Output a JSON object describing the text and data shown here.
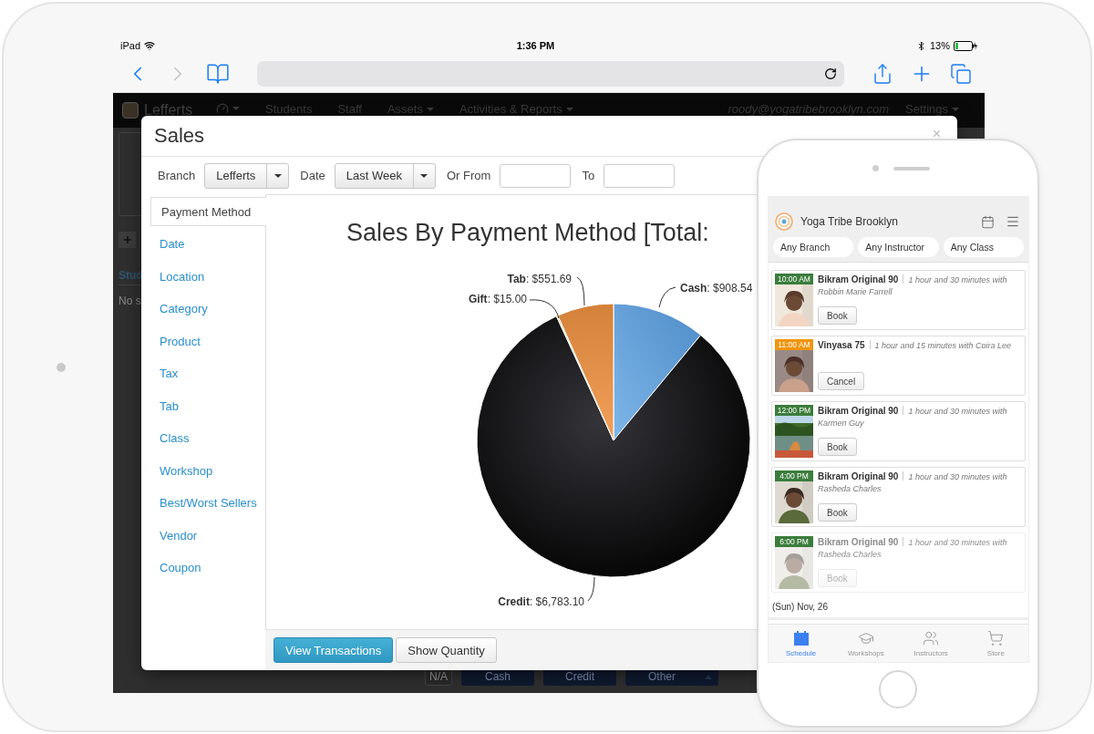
{
  "ipad_status_bar": {
    "device": "iPad",
    "time": "1:36 PM",
    "battery": "13%"
  },
  "browser": {
    "nav_buttons": [
      {
        "kind": "back",
        "disabled": false
      },
      {
        "kind": "forward",
        "disabled": true
      }
    ]
  },
  "web_app": {
    "nav": {
      "branch": "Lefferts",
      "items": [
        {
          "label": "Students",
          "dropdown": false
        },
        {
          "label": "Staff",
          "dropdown": false
        },
        {
          "label": "Assets",
          "dropdown": true
        },
        {
          "label": "Activities & Reports",
          "dropdown": true
        }
      ],
      "user": "roody@yogatribebrooklyn.com",
      "settings": {
        "label": "Settings",
        "dropdown": true
      }
    },
    "background": {
      "column_header": "Stud",
      "empty_text": "No s",
      "tag": "N/A",
      "buttons": [
        "Cash",
        "Credit",
        "Other"
      ]
    }
  },
  "sales_dialog": {
    "title": "Sales",
    "close": "×",
    "filters": [
      {
        "label": "Branch",
        "kind": "select",
        "value": "Lefferts"
      },
      {
        "label": "Date",
        "kind": "select",
        "value": "Last Week"
      },
      {
        "label": "Or From",
        "kind": "input"
      },
      {
        "label": "To",
        "kind": "input"
      }
    ],
    "report_types": [
      {
        "label": "Payment Method",
        "selected": true
      },
      {
        "label": "Date",
        "selected": false
      },
      {
        "label": "Location",
        "selected": false
      },
      {
        "label": "Category",
        "selected": false
      },
      {
        "label": "Product",
        "selected": false
      },
      {
        "label": "Tax",
        "selected": false
      },
      {
        "label": "Tab",
        "selected": false
      },
      {
        "label": "Class",
        "selected": false
      },
      {
        "label": "Workshop",
        "selected": false
      },
      {
        "label": "Best/Worst Sellers",
        "selected": false
      },
      {
        "label": "Vendor",
        "selected": false
      },
      {
        "label": "Coupon",
        "selected": false
      }
    ],
    "chart_title": "Sales By Payment Method [Total:",
    "chart_data": {
      "type": "pie",
      "categories": [
        "Cash",
        "Credit",
        "Gift",
        "Tab"
      ],
      "values": [
        908.54,
        6783.1,
        15.0,
        551.69
      ],
      "value_labels": [
        ": $908.54",
        ": $6,783.10",
        ": $15.00",
        ": $551.69"
      ]
    },
    "buttons": [
      {
        "label": "View Transactions",
        "primary": true
      },
      {
        "label": "Show Quantity",
        "primary": false
      }
    ]
  },
  "phone_app": {
    "title": "Yoga Tribe Brooklyn",
    "filters": [
      "Any Branch",
      "Any Instructor",
      "Any Class"
    ],
    "classes": [
      {
        "time": "10:00 AM",
        "color": "#3b7d3c",
        "name": "Bikram Original 90",
        "details": "1 hour and 30 minutes with Robbin Marie Farrell",
        "action": "Book",
        "disabled": false
      },
      {
        "time": "11:00 AM",
        "color": "#f0950e",
        "name": "Vinyasa 75",
        "details": "1 hour and 15 minutes with Coira Lee",
        "action": "Cancel",
        "disabled": false
      },
      {
        "time": "12:00 PM",
        "color": "#3b7d3c",
        "name": "Bikram Original 90",
        "details": "1 hour and 30 minutes with Karmen Guy",
        "action": "Book",
        "disabled": false
      },
      {
        "time": "4:00 PM",
        "color": "#3b7d3c",
        "name": "Bikram Original 90",
        "details": "1 hour and 30 minutes with Rasheda Charles",
        "action": "Book",
        "disabled": false
      },
      {
        "time": "6:00 PM",
        "color": "#3b7d3c",
        "name": "Bikram Original 90",
        "details": "1 hour and 30 minutes with Rasheda Charles",
        "action": "Book",
        "disabled": true
      }
    ],
    "date": "(Sun) Nov, 26",
    "tabs": [
      {
        "label": "Schedule",
        "selected": true
      },
      {
        "label": "Workshops",
        "selected": false
      },
      {
        "label": "Instructors",
        "selected": false
      },
      {
        "label": "Store",
        "selected": false
      }
    ]
  }
}
